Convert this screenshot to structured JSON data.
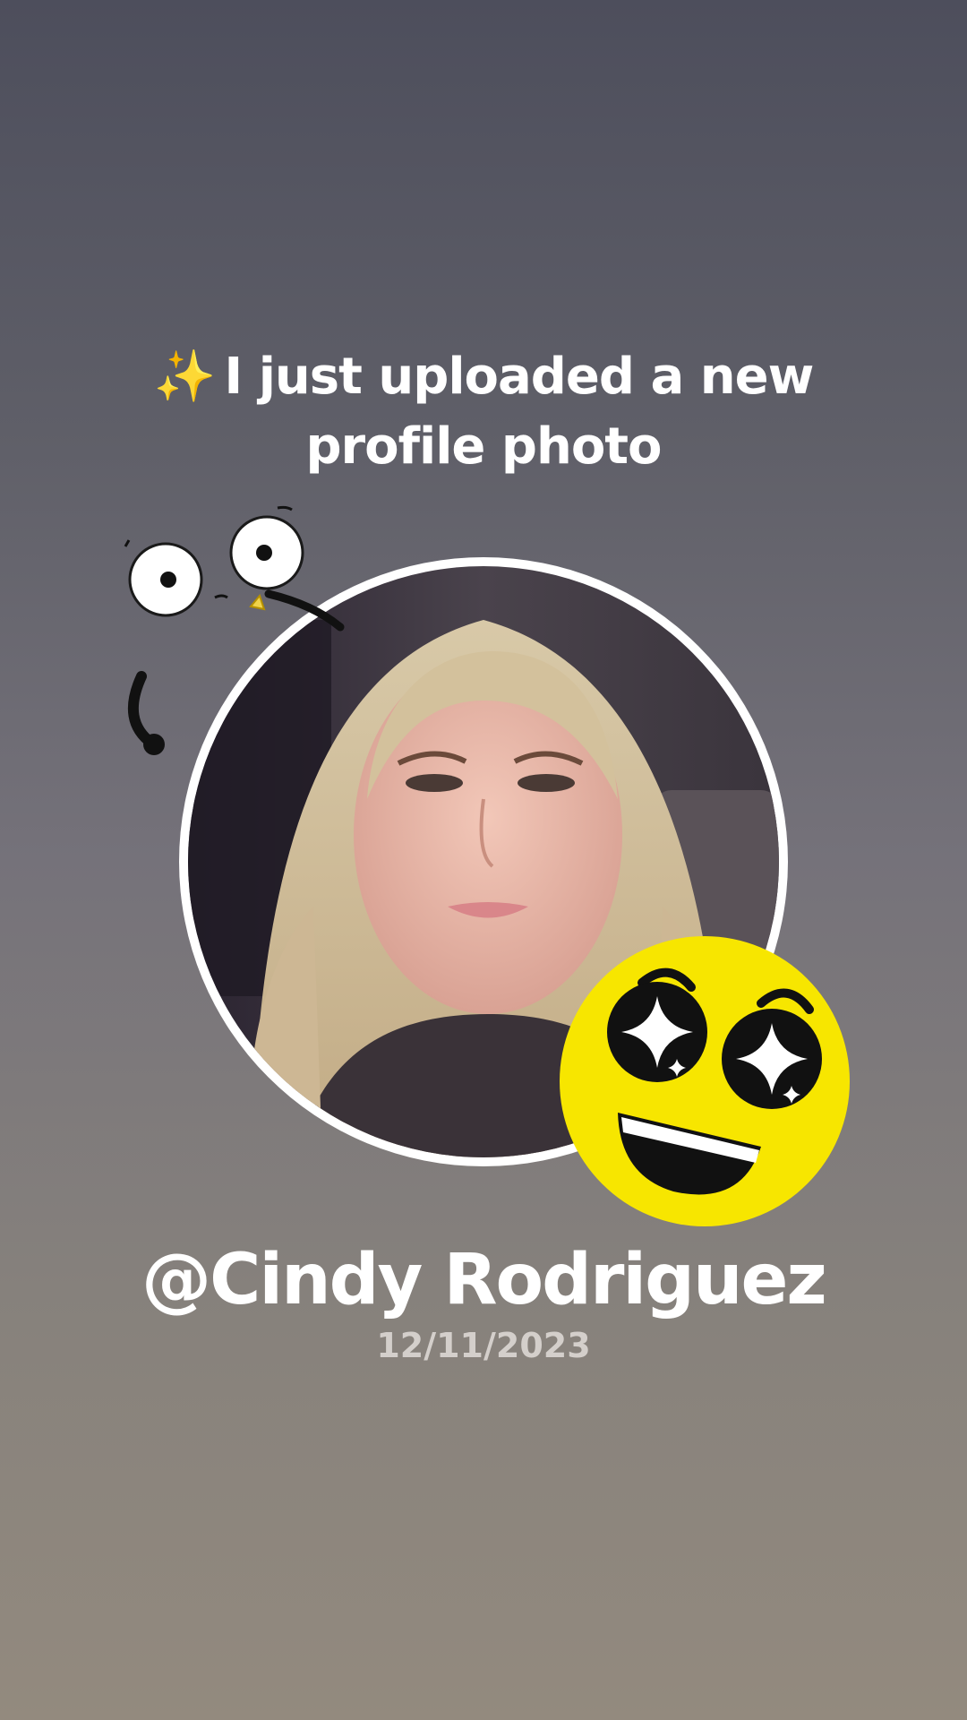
{
  "announcement": {
    "sparkle_icon": "sparkles-icon",
    "sparkle_glyph": "✨",
    "text": "I just uploaded a new profile photo"
  },
  "profile": {
    "username": "@Cindy Rodriguez",
    "date": "12/11/2023"
  },
  "stickers": {
    "doodle": "googly-eyes-doodle-icon",
    "smiley": "star-eyes-smiley-icon"
  },
  "colors": {
    "background_top": "#4d4e5c",
    "background_bottom": "#938a7e",
    "text": "#ffffff",
    "date_text": "#d4cfcb",
    "smiley_yellow": "#f7e600",
    "ring": "#ffffff"
  }
}
